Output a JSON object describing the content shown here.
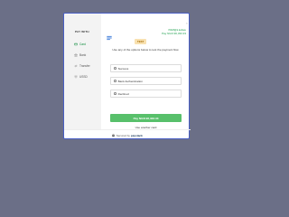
{
  "sidebar": {
    "heading": "PAY WITH",
    "items": [
      {
        "label": "Card",
        "icon": "card-icon",
        "active": true
      },
      {
        "label": "Bank",
        "icon": "bank-icon",
        "active": false
      },
      {
        "label": "Transfer",
        "icon": "transfer-icon",
        "active": false
      },
      {
        "label": "USSD",
        "icon": "ussd-icon",
        "active": false
      }
    ]
  },
  "header": {
    "email": "f9br8@k.kabwe",
    "pay_text": "Pay NGN 96,333.33",
    "close_icon": "close-icon"
  },
  "badge": "TEST",
  "instruction": "Use any of the options below to test the payment flow",
  "options": [
    {
      "label": "Success"
    },
    {
      "label": "Bank Authentication"
    },
    {
      "label": "Declined"
    }
  ],
  "pay_button": "Pay NGN 96,333.33",
  "another_card": "Use another card",
  "footer": {
    "secured_by": "Secured by",
    "brand": "paystack"
  },
  "colors": {
    "accent": "#58c06b",
    "active_nav": "#0a8a3a",
    "badge_bg": "#f8e1b0",
    "backdrop": "#6b6f87",
    "border": "#4a5fc4"
  }
}
